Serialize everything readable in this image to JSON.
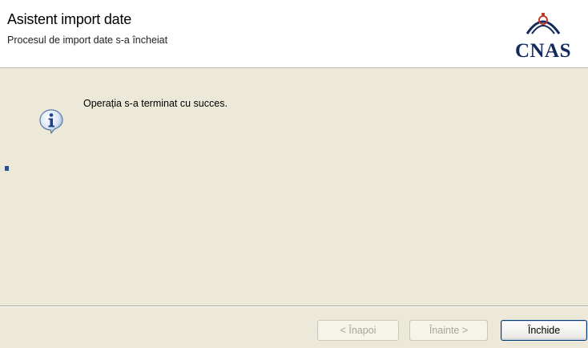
{
  "header": {
    "title": "Asistent import date",
    "subtitle": "Procesul de import date s-a încheiat",
    "logo_text": "CNAS",
    "logo_icon": "cnas-logo-icon"
  },
  "content": {
    "icon": "info-icon",
    "message": "Operația s-a terminat cu succes."
  },
  "buttons": {
    "back_label": "< Înapoi",
    "next_label": "Înainte >",
    "close_label": "Închide"
  },
  "colors": {
    "dialog_bg": "#ece9d8",
    "header_bg": "#ffffff",
    "logo_blue": "#142a5c",
    "logo_red": "#c0392b"
  }
}
